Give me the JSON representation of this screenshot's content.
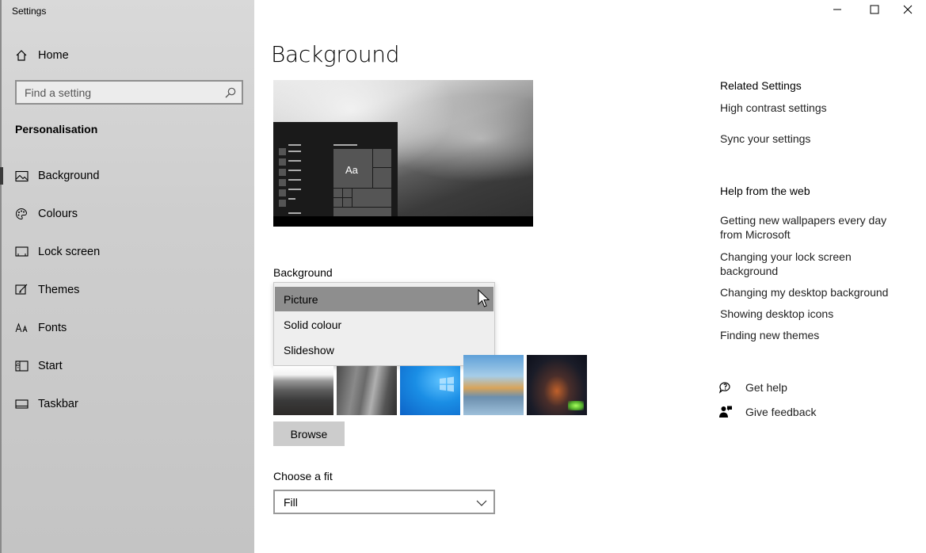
{
  "window": {
    "title": "Settings",
    "controls": [
      "minimize-icon",
      "maximize-icon",
      "close-icon"
    ]
  },
  "sidebar": {
    "home_label": "Home",
    "search_placeholder": "Find a setting",
    "section": "Personalisation",
    "items": [
      {
        "label": "Background",
        "icon": "picture-icon",
        "selected": true
      },
      {
        "label": "Colours",
        "icon": "palette-icon",
        "selected": false
      },
      {
        "label": "Lock screen",
        "icon": "lock-screen-icon",
        "selected": false
      },
      {
        "label": "Themes",
        "icon": "themes-icon",
        "selected": false
      },
      {
        "label": "Fonts",
        "icon": "fonts-icon",
        "selected": false
      },
      {
        "label": "Start",
        "icon": "start-icon",
        "selected": false
      },
      {
        "label": "Taskbar",
        "icon": "taskbar-icon",
        "selected": false
      }
    ]
  },
  "main": {
    "title": "Background",
    "preview_sample_text": "Aa",
    "background_label": "Background",
    "background_dropdown": {
      "options": [
        "Picture",
        "Solid colour",
        "Slideshow"
      ],
      "selected": "Picture"
    },
    "browse_label": "Browse",
    "fit_label": "Choose a fit",
    "fit_value": "Fill"
  },
  "related": {
    "heading": "Related Settings",
    "links": [
      "High contrast settings",
      "Sync your settings"
    ]
  },
  "help": {
    "heading": "Help from the web",
    "links": [
      "Getting new wallpapers every day from Microsoft",
      "Changing your lock screen background",
      "Changing my desktop background",
      "Showing desktop icons",
      "Finding new themes"
    ],
    "get_help": "Get help",
    "give_feedback": "Give feedback"
  },
  "colors": {
    "sidebar_bg": "#d0d0d0",
    "selected_option": "#8e8e8e",
    "button_bg": "#cccccc"
  }
}
